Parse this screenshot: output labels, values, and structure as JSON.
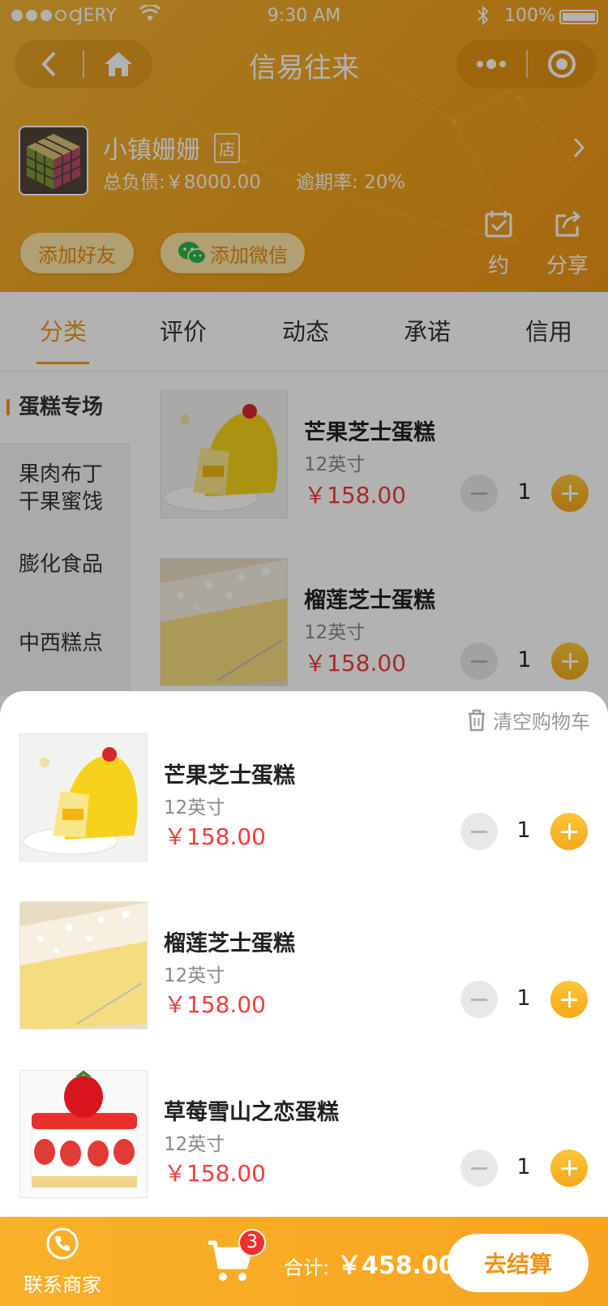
{
  "statusbar": {
    "carrier": "JERY",
    "time": "9:30 AM",
    "battery": "100%"
  },
  "nav": {
    "title": "信易往来",
    "back_icon": "chevron-left-icon",
    "home_icon": "home-icon",
    "more_icon": "more-dots-icon",
    "target_icon": "target-icon"
  },
  "shop": {
    "name": "小镇姗姗",
    "tag": "店",
    "debt": "总负债:￥8000.00",
    "overdue": "逾期率:  20%"
  },
  "actions": {
    "add_friend": "添加好友",
    "add_wechat": "添加微信",
    "book": "约",
    "share": "分享"
  },
  "tabs": [
    {
      "label": "分类"
    },
    {
      "label": "评价"
    },
    {
      "label": "动态"
    },
    {
      "label": "承诺"
    },
    {
      "label": "信用"
    }
  ],
  "categories": [
    {
      "label": "蛋糕专场"
    },
    {
      "label": "果肉布丁\n干果蜜饯"
    },
    {
      "label": "膨化食品"
    },
    {
      "label": "中西糕点"
    }
  ],
  "products": [
    {
      "name": "芒果芝士蛋糕",
      "size": "12英寸",
      "price": "￥158.00",
      "qty": "1"
    },
    {
      "name": "榴莲芝士蛋糕",
      "size": "12英寸",
      "price": "￥158.00",
      "qty": "1"
    }
  ],
  "cart": {
    "clear_label": "清空购物车",
    "items": [
      {
        "name": "芒果芝士蛋糕",
        "size": "12英寸",
        "price": "￥158.00",
        "qty": "1"
      },
      {
        "name": "榴莲芝士蛋糕",
        "size": "12英寸",
        "price": "￥158.00",
        "qty": "1"
      },
      {
        "name": "草莓雪山之恋蛋糕",
        "size": "12英寸",
        "price": "￥158.00",
        "qty": "1"
      }
    ]
  },
  "bottom": {
    "contact": "联系商家",
    "cart_count": "3",
    "total_label": "合计:",
    "total_value": "￥458.00",
    "checkout": "去结算"
  },
  "colors": {
    "accent": "#ef9a16",
    "price": "#f03d3d",
    "header_bg": "#f0a21d"
  }
}
